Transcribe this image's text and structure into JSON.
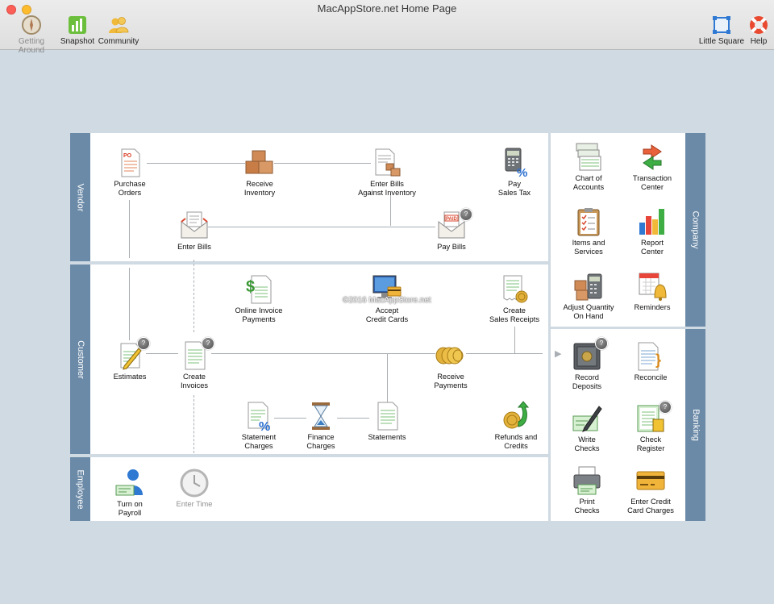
{
  "window": {
    "title": "MacAppStore.net Home Page"
  },
  "toolbar": {
    "getting_around": "Getting Around",
    "snapshot": "Snapshot",
    "community": "Community",
    "little_square": "Little Square",
    "help": "Help"
  },
  "sections": {
    "vendor": "Vendor",
    "customer": "Customer",
    "employee": "Employee",
    "company": "Company",
    "banking": "Banking"
  },
  "vendor": {
    "purchase_orders": "Purchase\nOrders",
    "receive_inventory": "Receive\nInventory",
    "enter_bills_against_inventory": "Enter Bills\nAgainst Inventory",
    "pay_sales_tax": "Pay\nSales Tax",
    "enter_bills": "Enter Bills",
    "pay_bills": "Pay Bills"
  },
  "customer": {
    "online_invoice_payments": "Online Invoice\nPayments",
    "accept_credit_cards": "Accept\nCredit Cards",
    "create_sales_receipts": "Create\nSales Receipts",
    "estimates": "Estimates",
    "create_invoices": "Create\nInvoices",
    "receive_payments": "Receive\nPayments",
    "statement_charges": "Statement\nCharges",
    "finance_charges": "Finance\nCharges",
    "statements": "Statements",
    "refunds_and_credits": "Refunds and\nCredits"
  },
  "employee": {
    "turn_on_payroll": "Turn on\nPayroll",
    "enter_time": "Enter Time"
  },
  "company": {
    "chart_of_accounts": "Chart of\nAccounts",
    "transaction_center": "Transaction\nCenter",
    "items_and_services": "Items and\nServices",
    "report_center": "Report\nCenter",
    "adjust_quantity_on_hand": "Adjust Quantity\nOn Hand",
    "reminders": "Reminders"
  },
  "banking": {
    "record_deposits": "Record\nDeposits",
    "reconcile": "Reconcile",
    "write_checks": "Write\nChecks",
    "check_register": "Check\nRegister",
    "print_checks": "Print\nChecks",
    "enter_credit_card_charges": "Enter Credit\nCard Charges"
  },
  "badges": {
    "help_badge": "?"
  },
  "watermark": "©2016 MacAppStore.net",
  "colors": {
    "section_band": "#6b8aa7",
    "background": "#cfdae3",
    "panel": "#ffffff"
  }
}
